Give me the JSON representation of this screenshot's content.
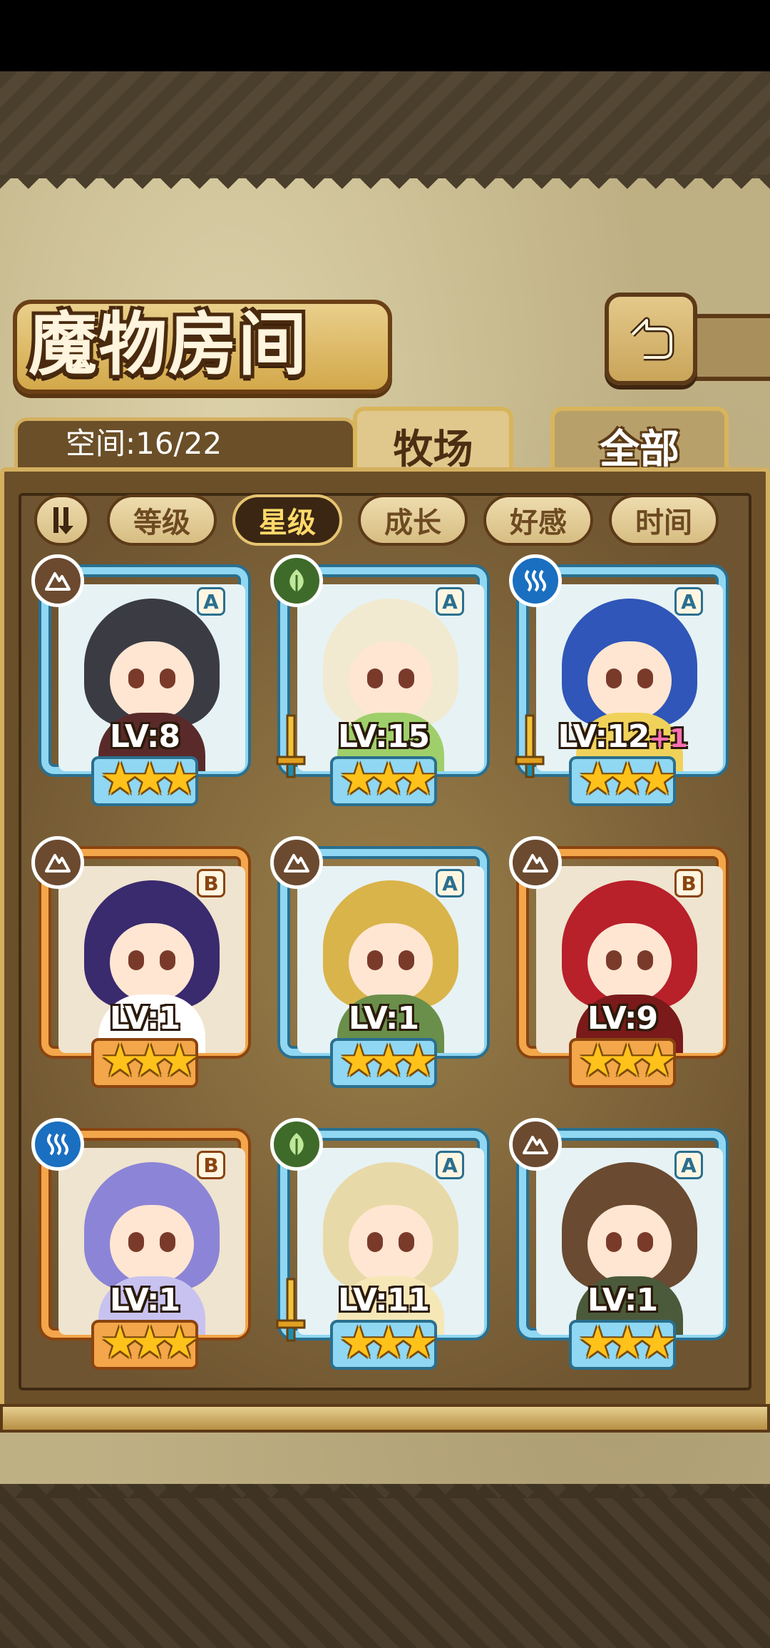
{
  "screen": {
    "title": "魔物房间",
    "space_label": "空间:16/22"
  },
  "tabs": [
    {
      "label": "牧场",
      "active": true
    },
    {
      "label": "全部",
      "active": false
    }
  ],
  "sort_buttons": [
    {
      "label": "等级",
      "active": false
    },
    {
      "label": "星级",
      "active": true
    },
    {
      "label": "成长",
      "active": false
    },
    {
      "label": "好感",
      "active": false
    },
    {
      "label": "时间",
      "active": false
    }
  ],
  "monsters": [
    {
      "level": "LV:8",
      "bonus": "",
      "rarity": "A",
      "element": "earth-icon",
      "stars": 3,
      "frame": "blue",
      "weapon": false,
      "hair": "#3b3b44",
      "outfit": "#5a2a2a"
    },
    {
      "level": "LV:15",
      "bonus": "",
      "rarity": "A",
      "element": "leaf-icon",
      "stars": 3,
      "frame": "blue",
      "weapon": true,
      "hair": "#f1ead0",
      "outfit": "#9fcf6a"
    },
    {
      "level": "LV:12",
      "bonus": "+1",
      "rarity": "A",
      "element": "water-icon",
      "stars": 3,
      "frame": "blue",
      "weapon": true,
      "hair": "#2f56b8",
      "outfit": "#f0d25a"
    },
    {
      "level": "LV:1",
      "bonus": "",
      "rarity": "B",
      "element": "earth-icon",
      "stars": 3,
      "frame": "orange",
      "weapon": false,
      "hair": "#3a2a6e",
      "outfit": "#ffffff"
    },
    {
      "level": "LV:1",
      "bonus": "",
      "rarity": "A",
      "element": "earth-icon",
      "stars": 3,
      "frame": "blue",
      "weapon": false,
      "hair": "#d9b44a",
      "outfit": "#6a8f4a"
    },
    {
      "level": "LV:9",
      "bonus": "",
      "rarity": "B",
      "element": "earth-icon",
      "stars": 3,
      "frame": "orange",
      "weapon": false,
      "hair": "#b8202a",
      "outfit": "#7a1a1a"
    },
    {
      "level": "LV:1",
      "bonus": "",
      "rarity": "B",
      "element": "water-icon",
      "stars": 3,
      "frame": "orange",
      "weapon": false,
      "hair": "#8c84d6",
      "outfit": "#c8c2f0"
    },
    {
      "level": "LV:11",
      "bonus": "",
      "rarity": "A",
      "element": "leaf-icon",
      "stars": 3,
      "frame": "blue",
      "weapon": true,
      "hair": "#e8d9a8",
      "outfit": "#f6e7b6"
    },
    {
      "level": "LV:1",
      "bonus": "",
      "rarity": "A",
      "element": "earth-icon",
      "stars": 3,
      "frame": "blue",
      "weapon": false,
      "hair": "#6a4a30",
      "outfit": "#4a5a3a"
    }
  ],
  "colors": {
    "frame_blue": "#8fd7f2",
    "frame_orange": "#f3a64a",
    "star": "#ffc21a",
    "bonus": "#ff6fb5"
  }
}
